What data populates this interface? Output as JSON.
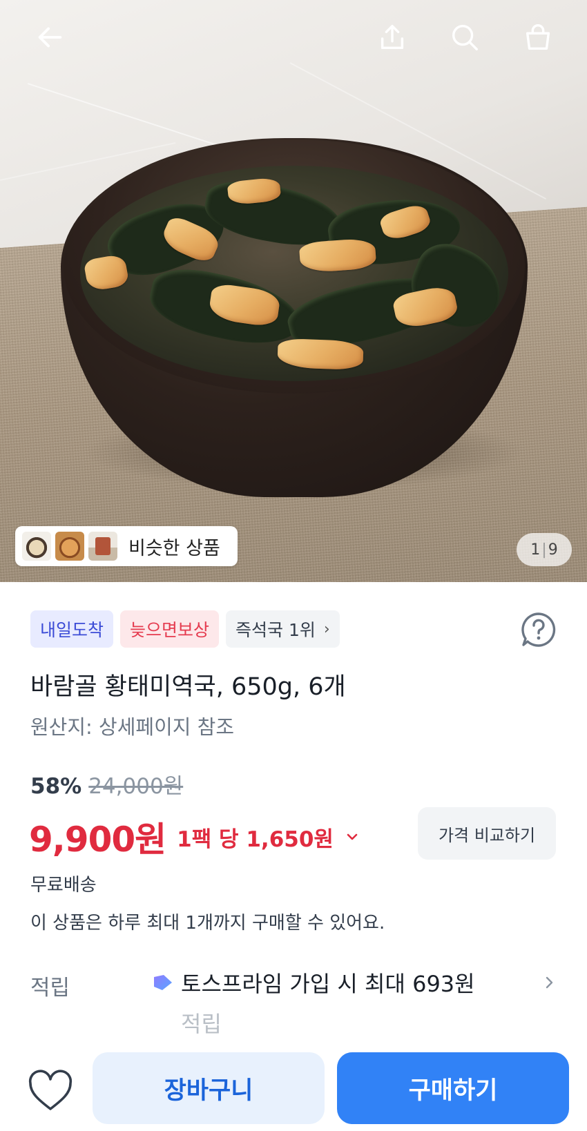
{
  "header": {
    "icons": [
      "back-arrow-icon",
      "share-icon",
      "search-icon",
      "shopping-bag-icon"
    ]
  },
  "gallery": {
    "similar_label": "비슷한 상품",
    "counter_current": "1",
    "counter_separator": "|",
    "counter_total": "9"
  },
  "badges": [
    {
      "label": "내일도착",
      "color": "#3b4bd6"
    },
    {
      "label": "늦으면보상",
      "color": "#e53b4f"
    },
    {
      "label": "즉석국 1위",
      "chevron": "›"
    }
  ],
  "product": {
    "title": "바람골 황태미역국, 650g, 6개",
    "origin": "원산지: 상세페이지 참조"
  },
  "pricing": {
    "discount": "58%",
    "original_price": "24,000원",
    "price": "9,900원",
    "unit_price": "1팩 당 1,650원",
    "compare_label": "가격 비교하기",
    "accent_color": "#e02b3f"
  },
  "delivery": {
    "shipping": "무료배송",
    "purchase_limit": "이 상품은 하루 최대 1개까지 구매할 수 있어요."
  },
  "reward": {
    "label": "적립",
    "text_line1": "토스프라임 가입 시 최대 693원",
    "text_line2": "적립"
  },
  "actions": {
    "cart_label": "장바구니",
    "buy_label": "구매하기",
    "primary_color": "#3182f6"
  }
}
